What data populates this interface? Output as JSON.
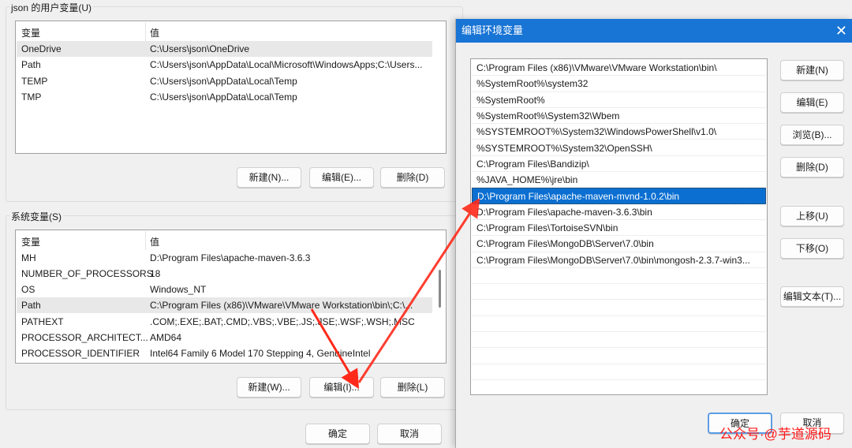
{
  "user_vars": {
    "group_label": "json 的用户变量(U)",
    "col_var": "变量",
    "col_val": "值",
    "rows": [
      {
        "name": "OneDrive",
        "value": "C:\\Users\\json\\OneDrive"
      },
      {
        "name": "Path",
        "value": "C:\\Users\\json\\AppData\\Local\\Microsoft\\WindowsApps;C:\\Users..."
      },
      {
        "name": "TEMP",
        "value": "C:\\Users\\json\\AppData\\Local\\Temp"
      },
      {
        "name": "TMP",
        "value": "C:\\Users\\json\\AppData\\Local\\Temp"
      }
    ],
    "new_label": "新建(N)...",
    "edit_label": "编辑(E)...",
    "delete_label": "删除(D)"
  },
  "sys_vars": {
    "group_label": "系统变量(S)",
    "col_var": "变量",
    "col_val": "值",
    "rows": [
      {
        "name": "MH",
        "value": "D:\\Program Files\\apache-maven-3.6.3"
      },
      {
        "name": "NUMBER_OF_PROCESSORS",
        "value": "18"
      },
      {
        "name": "OS",
        "value": "Windows_NT"
      },
      {
        "name": "Path",
        "value": "C:\\Program Files (x86)\\VMware\\VMware Workstation\\bin\\;C:\\..."
      },
      {
        "name": "PATHEXT",
        "value": ".COM;.EXE;.BAT;.CMD;.VBS;.VBE;.JS;.JSE;.WSF;.WSH;.MSC"
      },
      {
        "name": "PROCESSOR_ARCHITECT...",
        "value": "AMD64"
      },
      {
        "name": "PROCESSOR_IDENTIFIER",
        "value": "Intel64 Family 6 Model 170 Stepping 4, GenuineIntel"
      }
    ],
    "new_label": "新建(W)...",
    "edit_label": "编辑(I)...",
    "delete_label": "删除(L)"
  },
  "main_buttons": {
    "ok": "确定",
    "cancel": "取消"
  },
  "dialog": {
    "title": "编辑环境变量",
    "paths": [
      "C:\\Program Files (x86)\\VMware\\VMware Workstation\\bin\\",
      "%SystemRoot%\\system32",
      "%SystemRoot%",
      "%SystemRoot%\\System32\\Wbem",
      "%SYSTEMROOT%\\System32\\WindowsPowerShell\\v1.0\\",
      "%SYSTEMROOT%\\System32\\OpenSSH\\",
      "C:\\Program Files\\Bandizip\\",
      "%JAVA_HOME%\\jre\\bin",
      "D:\\Program Files\\apache-maven-mvnd-1.0.2\\bin",
      "D:\\Program Files\\apache-maven-3.6.3\\bin",
      "C:\\Program Files\\TortoiseSVN\\bin",
      "C:\\Program Files\\MongoDB\\Server\\7.0\\bin",
      "C:\\Program Files\\MongoDB\\Server\\7.0\\bin\\mongosh-2.3.7-win3..."
    ],
    "selected_index": 8,
    "buttons": {
      "new": "新建(N)",
      "edit": "编辑(E)",
      "browse": "浏览(B)...",
      "delete": "删除(D)",
      "up": "上移(U)",
      "down": "下移(O)",
      "edit_text": "编辑文本(T)..."
    },
    "ok": "确定",
    "cancel": "取消"
  },
  "watermark": "公众号·@芋道源码",
  "colors": {
    "title_bar": "#1874d5",
    "selection": "#0b6fd1",
    "arrow": "#ff2a1a"
  }
}
